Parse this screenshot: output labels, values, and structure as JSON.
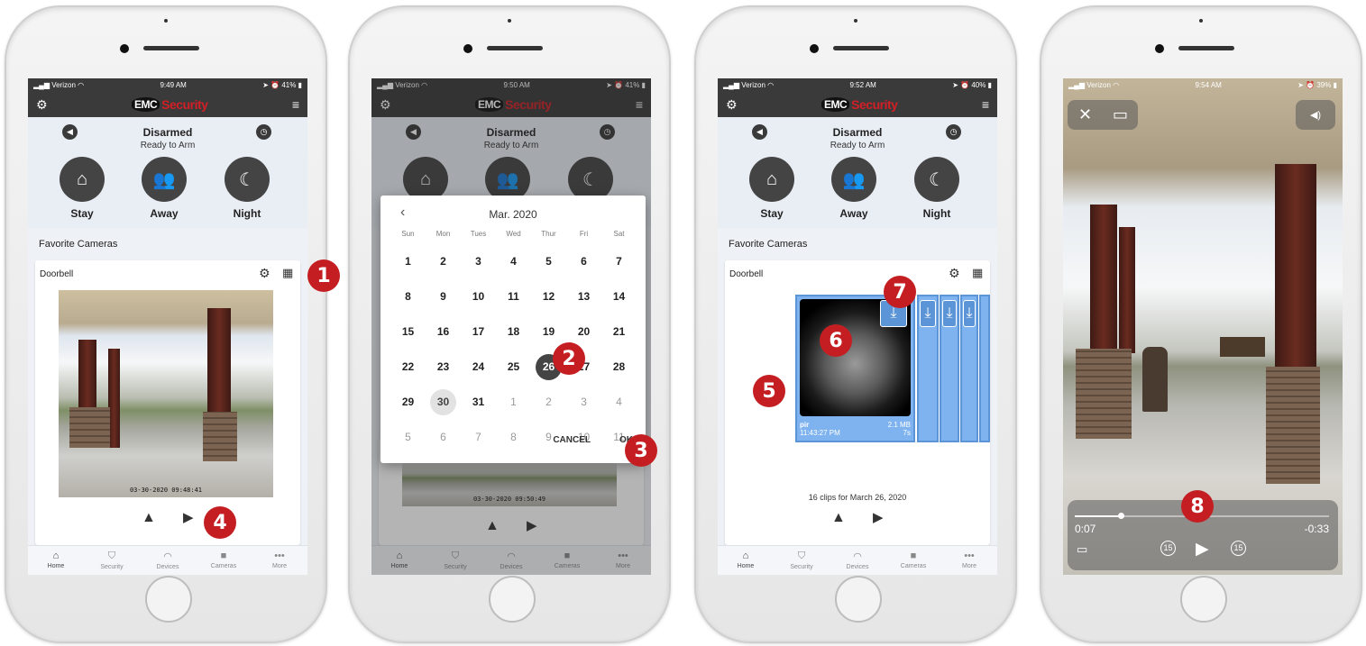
{
  "phones": [
    {
      "status": {
        "carrier": "Verizon",
        "time": "9:49 AM",
        "battery": "41%"
      },
      "panel": {
        "status": "Disarmed",
        "sub": "Ready to Arm",
        "modes": [
          "Stay",
          "Away",
          "Night"
        ]
      },
      "favorites": "Favorite Cameras",
      "camera": {
        "name": "Doorbell",
        "timestamp": "03-30-2020 09:48:41"
      },
      "badges": [
        "1",
        "4"
      ]
    },
    {
      "status": {
        "carrier": "Verizon",
        "time": "9:50 AM",
        "battery": "41%"
      },
      "panel": {
        "status": "Disarmed",
        "sub": "Ready to Arm"
      },
      "camera": {
        "timestamp": "03-30-2020 09:50:49"
      },
      "calendar": {
        "month": "Mar. 2020",
        "weekdays": [
          "Sun",
          "Mon",
          "Tues",
          "Wed",
          "Thur",
          "Fri",
          "Sat"
        ],
        "days": [
          "1",
          "2",
          "3",
          "4",
          "5",
          "6",
          "7",
          "8",
          "9",
          "10",
          "11",
          "12",
          "13",
          "14",
          "15",
          "16",
          "17",
          "18",
          "19",
          "20",
          "21",
          "22",
          "23",
          "24",
          "25",
          "26",
          "27",
          "28",
          "29",
          "30",
          "31",
          "1",
          "2",
          "3",
          "4",
          "5",
          "6",
          "7",
          "8",
          "9",
          "10",
          "11"
        ],
        "cancel": "CANCEL",
        "ok": "OK"
      },
      "badges": [
        "2",
        "3"
      ]
    },
    {
      "status": {
        "carrier": "Verizon",
        "time": "9:52 AM",
        "battery": "40%"
      },
      "panel": {
        "status": "Disarmed",
        "sub": "Ready to Arm",
        "modes": [
          "Stay",
          "Away",
          "Night"
        ]
      },
      "favorites": "Favorite Cameras",
      "camera": {
        "name": "Doorbell"
      },
      "clip": {
        "trigger": "pir",
        "size": "2.1 MB",
        "time": "11:43:27 PM",
        "duration": "7s"
      },
      "clips_summary": "16 clips for March 26, 2020",
      "badges": [
        "5",
        "6",
        "7"
      ]
    },
    {
      "status": {
        "carrier": "Verizon",
        "time": "9:54 AM",
        "battery": "39%"
      },
      "player": {
        "elapsed": "0:07",
        "remaining": "-0:33",
        "skip_back": "15",
        "skip_fwd": "15",
        "progress": 0.18
      },
      "badges": [
        "8"
      ]
    }
  ],
  "tabs": [
    "Home",
    "Security",
    "Devices",
    "Cameras",
    "More"
  ],
  "logo": {
    "brand": "EMC",
    "word": "Security"
  }
}
